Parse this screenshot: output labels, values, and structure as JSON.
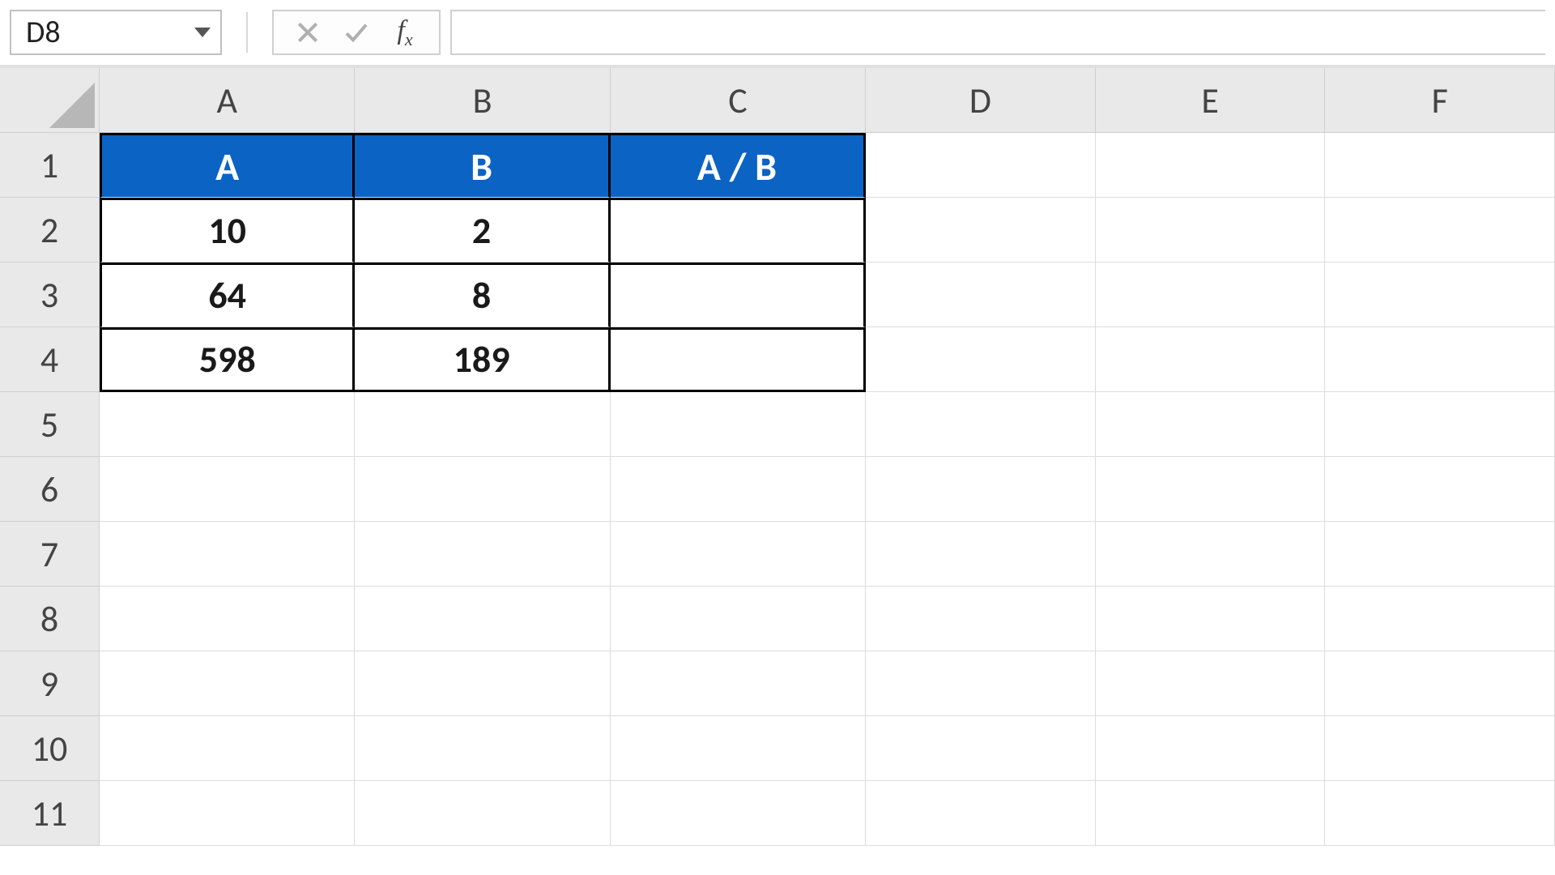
{
  "name_box": {
    "value": "D8"
  },
  "formula_bar": {
    "value": ""
  },
  "icons": {
    "cancel": "×",
    "enter": "✓"
  },
  "columns": [
    "A",
    "B",
    "C",
    "D",
    "E",
    "F"
  ],
  "row_numbers": [
    "1",
    "2",
    "3",
    "4",
    "5",
    "6",
    "7",
    "8",
    "9",
    "10",
    "11"
  ],
  "table": {
    "header": {
      "A": "A",
      "B": "B",
      "C": "A / B"
    },
    "rows": [
      {
        "A": "10",
        "B": "2",
        "C": ""
      },
      {
        "A": "64",
        "B": "8",
        "C": ""
      },
      {
        "A": "598",
        "B": "189",
        "C": ""
      }
    ]
  },
  "chart_data": {
    "type": "table",
    "title": "",
    "columns": [
      "A",
      "B",
      "A / B"
    ],
    "rows": [
      [
        10,
        2,
        null
      ],
      [
        64,
        8,
        null
      ],
      [
        598,
        189,
        null
      ]
    ]
  },
  "colors": {
    "header_fill": "#0b63c4",
    "header_text": "#ffffff"
  }
}
